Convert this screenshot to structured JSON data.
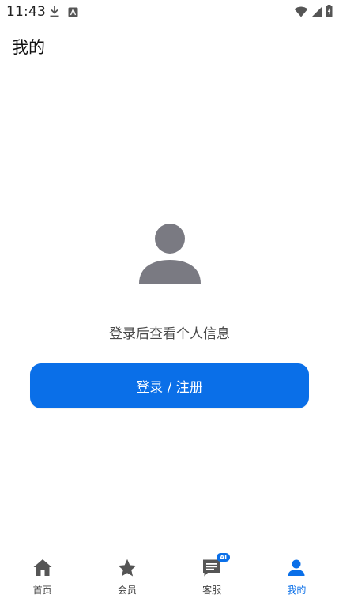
{
  "status_bar": {
    "time": "11:43",
    "left_icons": [
      "download-icon",
      "text-a-icon"
    ],
    "right_icons": [
      "wifi-icon",
      "cellular-signal-icon",
      "battery-icon"
    ]
  },
  "page": {
    "title": "我的"
  },
  "profile": {
    "avatar_icon": "person-icon",
    "hint": "登录后查看个人信息",
    "login_button_label": "登录 / 注册"
  },
  "bottom_nav": {
    "items": [
      {
        "label": "首页",
        "icon": "home-icon",
        "active": false
      },
      {
        "label": "会员",
        "icon": "star-icon",
        "active": false
      },
      {
        "label": "客服",
        "icon": "chat-icon",
        "active": false,
        "badge": "AI"
      },
      {
        "label": "我的",
        "icon": "person-icon",
        "active": true
      }
    ]
  },
  "colors": {
    "accent": "#0a6fe8",
    "avatar_gray": "#7a7a82",
    "nav_icon_gray": "#555555"
  }
}
